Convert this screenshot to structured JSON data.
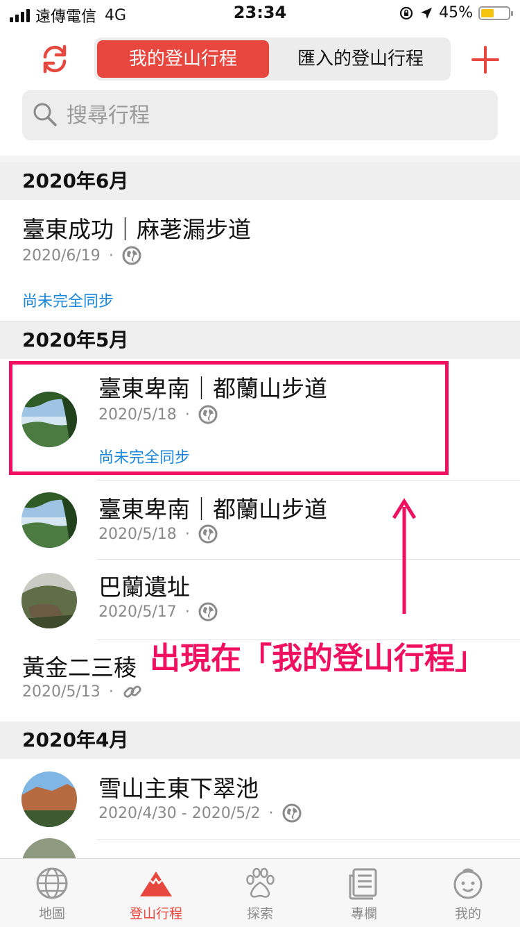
{
  "status_bar": {
    "carrier": "遠傳電信",
    "network": "4G",
    "time": "23:34",
    "battery": "45%"
  },
  "nav": {
    "tab_mine": "我的登山行程",
    "tab_imported": "匯入的登山行程",
    "accent_color": "#e8473f"
  },
  "search": {
    "placeholder": "搜尋行程"
  },
  "sections": [
    {
      "month": "2020年6月",
      "items": [
        {
          "title": "臺東成功｜麻荖漏步道",
          "date": "2020/6/19",
          "sync": "尚未完全同步"
        }
      ]
    },
    {
      "month": "2020年5月",
      "items": [
        {
          "title": "臺東卑南｜都蘭山步道",
          "date": "2020/5/18",
          "sync": "尚未完全同步"
        },
        {
          "title": "臺東卑南｜都蘭山步道",
          "date": "2020/5/18"
        },
        {
          "title": "巴蘭遺址",
          "date": "2020/5/17"
        },
        {
          "title": "黃金二三稜",
          "date": "2020/5/13"
        }
      ]
    },
    {
      "month": "2020年4月",
      "items": [
        {
          "title": "雪山主東下翠池",
          "date": "2020/4/30 - 2020/5/2"
        }
      ]
    }
  ],
  "annotation": {
    "text": "出現在「我的登山行程」",
    "color": "#f0105f"
  },
  "tabbar": {
    "map": "地圖",
    "trips": "登山行程",
    "explore": "探索",
    "column": "專欄",
    "me": "我的"
  }
}
